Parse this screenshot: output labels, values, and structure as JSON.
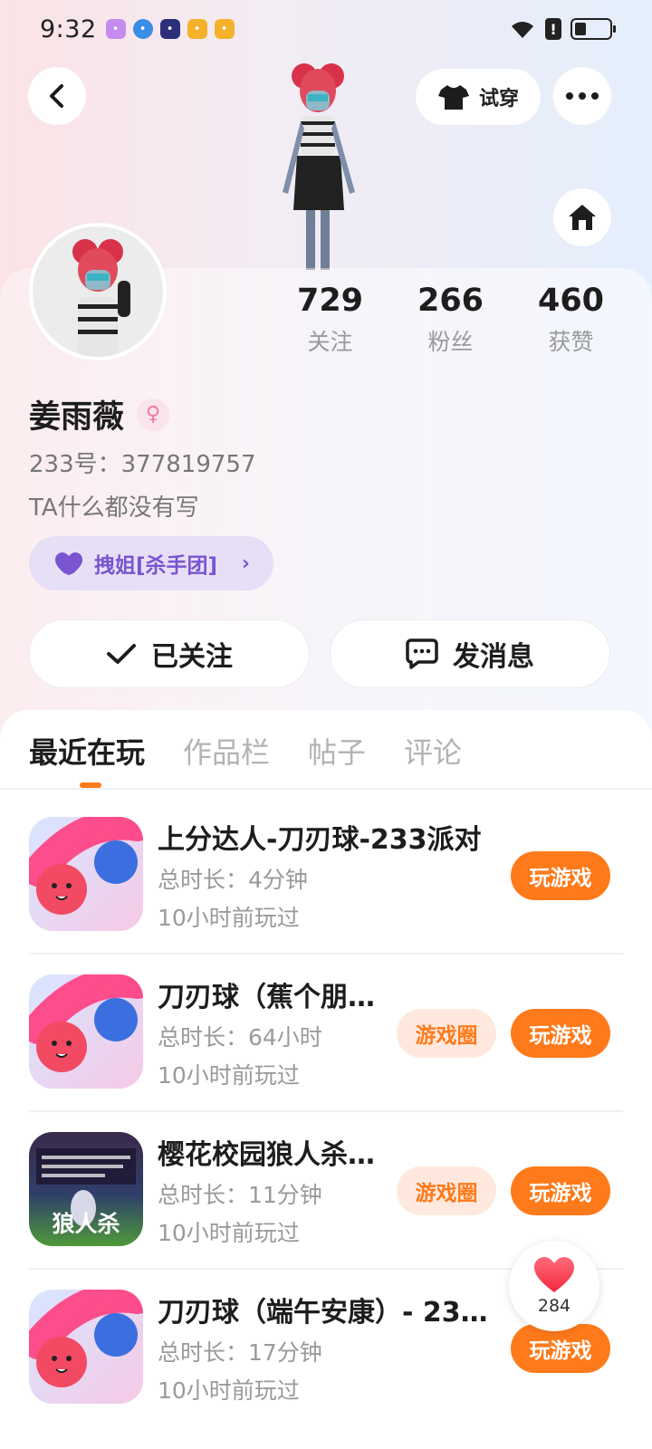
{
  "status_bar": {
    "time": "9:32"
  },
  "header": {
    "try_on_label": "试穿"
  },
  "profile": {
    "stats": [
      {
        "num": "729",
        "label": "关注"
      },
      {
        "num": "266",
        "label": "粉丝"
      },
      {
        "num": "460",
        "label": "获赞"
      }
    ],
    "name": "姜雨薇",
    "uid": "233号：377819757",
    "bio": "TA什么都没有写",
    "group_label": "拽姐[杀手团]",
    "followed_label": "已关注",
    "message_label": "发消息"
  },
  "tabs": [
    {
      "label": "最近在玩"
    },
    {
      "label": "作品栏"
    },
    {
      "label": "帖子"
    },
    {
      "label": "评论"
    }
  ],
  "games": [
    {
      "title": "上分达人-刀刃球-233派对",
      "duration": "总时长：4分钟",
      "last_played": "10小时前玩过",
      "play_label": "玩游戏",
      "circle_label": ""
    },
    {
      "title": "刀刃球（蕉个朋…",
      "duration": "总时长：64小时",
      "last_played": "10小时前玩过",
      "play_label": "玩游戏",
      "circle_label": "游戏圈"
    },
    {
      "title": "樱花校园狼人杀…",
      "duration": "总时长：11分钟",
      "last_played": "10小时前玩过",
      "play_label": "玩游戏",
      "circle_label": "游戏圈",
      "icon_text": "狼人杀"
    },
    {
      "title": "刀刃球（端午安康）- 23…",
      "duration": "总时长：17分钟",
      "last_played": "10小时前玩过",
      "play_label": "玩游戏",
      "circle_label": ""
    }
  ],
  "like_fab": {
    "count": "284"
  },
  "colors": {
    "accent": "#ff7a1a",
    "purple": "#7a54d1"
  }
}
